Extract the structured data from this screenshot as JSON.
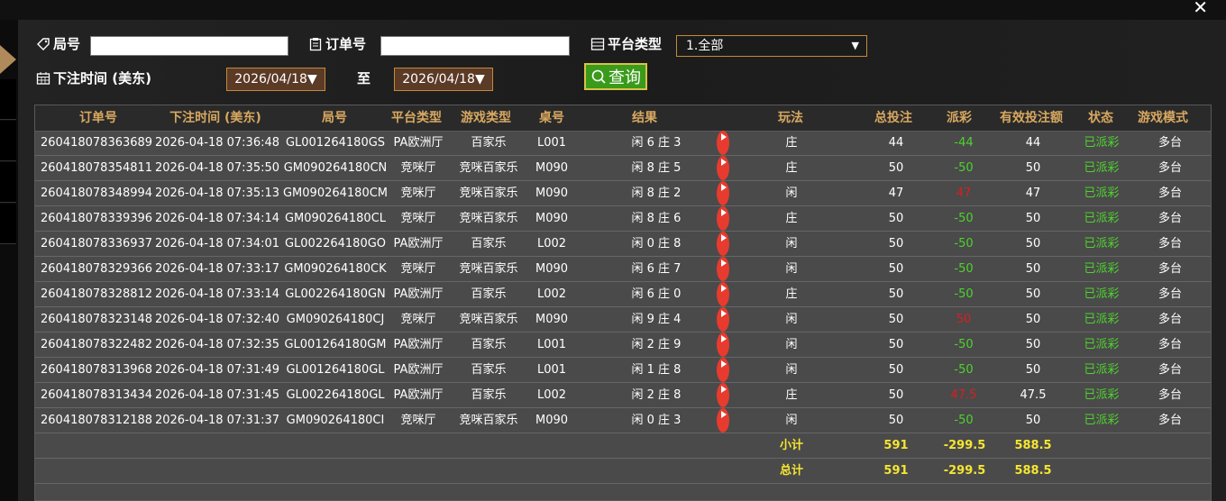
{
  "filters": {
    "ju_label": "局号",
    "order_label": "订单号",
    "platform_label": "平台类型",
    "platform_value": "1.全部",
    "time_label": "下注时间 (美东)",
    "date_from": "2026/04/18▼",
    "to_label": "至",
    "date_to": "2026/04/18▼",
    "query_label": "查询"
  },
  "table": {
    "headers": [
      "订单号",
      "下注时间 (美东)",
      "局号",
      "平台类型",
      "游戏类型",
      "桌号",
      "结果",
      "玩法",
      "总投注",
      "派彩",
      "有效投注额",
      "状态",
      "游戏模式"
    ],
    "rows": [
      {
        "order": "260418078363689",
        "time": "2026-04-18 07:36:48",
        "ju": "GL001264180GS",
        "platform": "PA欧洲厅",
        "game": "百家乐",
        "table": "L001",
        "result": "闲 6 庄 3",
        "play": "庄",
        "bet": "44",
        "payout": "-44",
        "pay_color": "green",
        "valid": "44",
        "status": "已派彩",
        "mode": "多台"
      },
      {
        "order": "260418078354811",
        "time": "2026-04-18 07:35:50",
        "ju": "GM090264180CN",
        "platform": "竞咪厅",
        "game": "竞咪百家乐",
        "table": "M090",
        "result": "闲 8 庄 5",
        "play": "庄",
        "bet": "50",
        "payout": "-50",
        "pay_color": "green",
        "valid": "50",
        "status": "已派彩",
        "mode": "多台"
      },
      {
        "order": "260418078348994",
        "time": "2026-04-18 07:35:13",
        "ju": "GM090264180CM",
        "platform": "竞咪厅",
        "game": "竞咪百家乐",
        "table": "M090",
        "result": "闲 8 庄 2",
        "play": "闲",
        "bet": "47",
        "payout": "47",
        "pay_color": "red",
        "valid": "47",
        "status": "已派彩",
        "mode": "多台"
      },
      {
        "order": "260418078339396",
        "time": "2026-04-18 07:34:14",
        "ju": "GM090264180CL",
        "platform": "竞咪厅",
        "game": "竞咪百家乐",
        "table": "M090",
        "result": "闲 8 庄 6",
        "play": "庄",
        "bet": "50",
        "payout": "-50",
        "pay_color": "green",
        "valid": "50",
        "status": "已派彩",
        "mode": "多台"
      },
      {
        "order": "260418078336937",
        "time": "2026-04-18 07:34:01",
        "ju": "GL002264180GO",
        "platform": "PA欧洲厅",
        "game": "百家乐",
        "table": "L002",
        "result": "闲 0 庄 8",
        "play": "闲",
        "bet": "50",
        "payout": "-50",
        "pay_color": "green",
        "valid": "50",
        "status": "已派彩",
        "mode": "多台"
      },
      {
        "order": "260418078329366",
        "time": "2026-04-18 07:33:17",
        "ju": "GM090264180CK",
        "platform": "竞咪厅",
        "game": "竞咪百家乐",
        "table": "M090",
        "result": "闲 6 庄 7",
        "play": "闲",
        "bet": "50",
        "payout": "-50",
        "pay_color": "green",
        "valid": "50",
        "status": "已派彩",
        "mode": "多台"
      },
      {
        "order": "260418078328812",
        "time": "2026-04-18 07:33:14",
        "ju": "GL002264180GN",
        "platform": "PA欧洲厅",
        "game": "百家乐",
        "table": "L002",
        "result": "闲 6 庄 0",
        "play": "庄",
        "bet": "50",
        "payout": "-50",
        "pay_color": "green",
        "valid": "50",
        "status": "已派彩",
        "mode": "多台"
      },
      {
        "order": "260418078323148",
        "time": "2026-04-18 07:32:40",
        "ju": "GM090264180CJ",
        "platform": "竞咪厅",
        "game": "竞咪百家乐",
        "table": "M090",
        "result": "闲 9 庄 4",
        "play": "闲",
        "bet": "50",
        "payout": "50",
        "pay_color": "red",
        "valid": "50",
        "status": "已派彩",
        "mode": "多台"
      },
      {
        "order": "260418078322482",
        "time": "2026-04-18 07:32:35",
        "ju": "GL001264180GM",
        "platform": "PA欧洲厅",
        "game": "百家乐",
        "table": "L001",
        "result": "闲 2 庄 9",
        "play": "闲",
        "bet": "50",
        "payout": "-50",
        "pay_color": "green",
        "valid": "50",
        "status": "已派彩",
        "mode": "多台"
      },
      {
        "order": "260418078313968",
        "time": "2026-04-18 07:31:49",
        "ju": "GL001264180GL",
        "platform": "PA欧洲厅",
        "game": "百家乐",
        "table": "L001",
        "result": "闲 1 庄 8",
        "play": "闲",
        "bet": "50",
        "payout": "-50",
        "pay_color": "green",
        "valid": "50",
        "status": "已派彩",
        "mode": "多台"
      },
      {
        "order": "260418078313434",
        "time": "2026-04-18 07:31:45",
        "ju": "GL002264180GL",
        "platform": "PA欧洲厅",
        "game": "百家乐",
        "table": "L002",
        "result": "闲 2 庄 8",
        "play": "庄",
        "bet": "50",
        "payout": "47.5",
        "pay_color": "red",
        "valid": "47.5",
        "status": "已派彩",
        "mode": "多台"
      },
      {
        "order": "260418078312188",
        "time": "2026-04-18 07:31:37",
        "ju": "GM090264180CI",
        "platform": "竞咪厅",
        "game": "竞咪百家乐",
        "table": "M090",
        "result": "闲 0 庄 3",
        "play": "闲",
        "bet": "50",
        "payout": "-50",
        "pay_color": "green",
        "valid": "50",
        "status": "已派彩",
        "mode": "多台"
      }
    ],
    "subtotal": {
      "label": "小计",
      "bet": "591",
      "payout": "-299.5",
      "valid": "588.5"
    },
    "total": {
      "label": "总计",
      "bet": "591",
      "payout": "-299.5",
      "valid": "588.5"
    }
  },
  "icons": {
    "close": "close-icon",
    "tag": "tag-icon",
    "clipboard": "clipboard-icon",
    "list": "list-icon",
    "calendar": "calendar-icon",
    "search": "search-icon",
    "play": "play-icon"
  },
  "colors": {
    "header_text": "#d8a860",
    "status_green": "#4ed22e",
    "payout_red": "#d81f1f",
    "sum_yellow": "#f5e630",
    "query_button": "#3a9a1a",
    "date_bg": "#5b3a26",
    "accent_border": "#c48a3a"
  }
}
